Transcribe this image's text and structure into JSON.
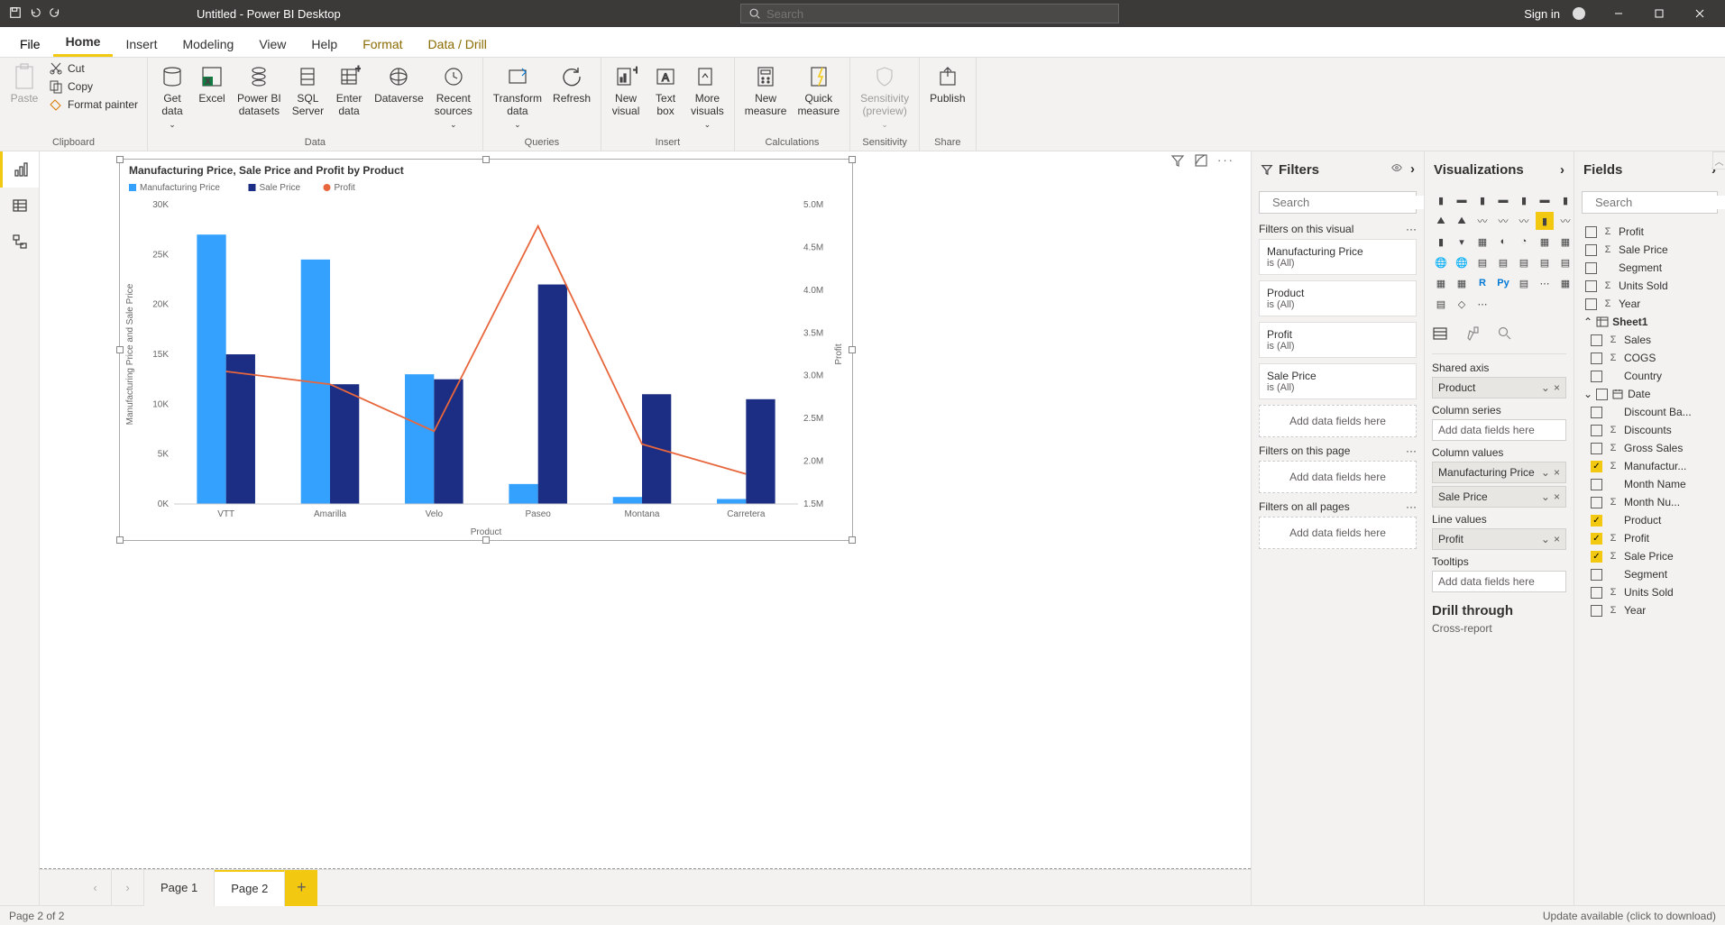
{
  "titlebar": {
    "title": "Untitled - Power BI Desktop",
    "search_placeholder": "Search",
    "signin": "Sign in"
  },
  "tabs": {
    "file": "File",
    "home": "Home",
    "insert": "Insert",
    "modeling": "Modeling",
    "view": "View",
    "help": "Help",
    "format": "Format",
    "datadrill": "Data / Drill"
  },
  "ribbon": {
    "paste": "Paste",
    "cut": "Cut",
    "copy": "Copy",
    "fmtpaint": "Format painter",
    "clipboard": "Clipboard",
    "getdata": "Get\ndata",
    "excel": "Excel",
    "pbi": "Power BI\ndatasets",
    "sql": "SQL\nServer",
    "enter": "Enter\ndata",
    "dataverse": "Dataverse",
    "recent": "Recent\nsources",
    "data_g": "Data",
    "transform": "Transform\ndata",
    "refresh": "Refresh",
    "queries": "Queries",
    "newvis": "New\nvisual",
    "textbox": "Text\nbox",
    "morevis": "More\nvisuals",
    "insert_g": "Insert",
    "newmeas": "New\nmeasure",
    "quickmeas": "Quick\nmeasure",
    "calc_g": "Calculations",
    "sens": "Sensitivity\n(preview)",
    "sens_g": "Sensitivity",
    "publish": "Publish",
    "share_g": "Share"
  },
  "pages": {
    "p1": "Page 1",
    "p2": "Page 2"
  },
  "status": {
    "left": "Page 2 of 2",
    "right": "Update available (click to download)"
  },
  "filters": {
    "title": "Filters",
    "search": "Search",
    "onvisual": "Filters on this visual",
    "cards": [
      {
        "t": "Manufacturing Price",
        "s": "is (All)"
      },
      {
        "t": "Product",
        "s": "is (All)"
      },
      {
        "t": "Profit",
        "s": "is (All)"
      },
      {
        "t": "Sale Price",
        "s": "is (All)"
      }
    ],
    "addhere": "Add data fields here",
    "onpage": "Filters on this page",
    "onall": "Filters on all pages"
  },
  "viz": {
    "title": "Visualizations",
    "shared_axis": "Shared axis",
    "product": "Product",
    "col_series": "Column series",
    "add": "Add data fields here",
    "col_values": "Column values",
    "mfg": "Manufacturing Price",
    "sale": "Sale Price",
    "line_values": "Line values",
    "profit": "Profit",
    "tooltips": "Tooltips",
    "drill": "Drill through",
    "cross": "Cross-report"
  },
  "fields": {
    "title": "Fields",
    "search": "Search",
    "top": [
      {
        "n": "Profit",
        "sig": "Σ",
        "ck": false
      },
      {
        "n": "Sale Price",
        "sig": "Σ",
        "ck": false
      },
      {
        "n": "Segment",
        "sig": "",
        "ck": false
      },
      {
        "n": "Units Sold",
        "sig": "Σ",
        "ck": false
      },
      {
        "n": "Year",
        "sig": "Σ",
        "ck": false
      }
    ],
    "sheet": "Sheet1",
    "sheet_fields": [
      {
        "n": "Sales",
        "sig": "Σ",
        "ck": false
      },
      {
        "n": "COGS",
        "sig": "Σ",
        "ck": false
      },
      {
        "n": "Country",
        "sig": "",
        "ck": false
      }
    ],
    "date": "Date",
    "date_fields": [
      {
        "n": "Discount Ba...",
        "sig": "",
        "ck": false
      },
      {
        "n": "Discounts",
        "sig": "Σ",
        "ck": false
      },
      {
        "n": "Gross Sales",
        "sig": "Σ",
        "ck": false
      },
      {
        "n": "Manufactur...",
        "sig": "Σ",
        "ck": true
      },
      {
        "n": "Month Name",
        "sig": "",
        "ck": false
      },
      {
        "n": "Month Nu...",
        "sig": "Σ",
        "ck": false
      },
      {
        "n": "Product",
        "sig": "",
        "ck": true
      },
      {
        "n": "Profit",
        "sig": "Σ",
        "ck": true
      },
      {
        "n": "Sale Price",
        "sig": "Σ",
        "ck": true
      },
      {
        "n": "Segment",
        "sig": "",
        "ck": false
      },
      {
        "n": "Units Sold",
        "sig": "Σ",
        "ck": false
      },
      {
        "n": "Year",
        "sig": "Σ",
        "ck": false
      }
    ]
  },
  "chart_data": {
    "type": "bar",
    "title": "Manufacturing Price, Sale Price and Profit by Product",
    "xlabel": "Product",
    "ylabel": "Manufacturing Price and Sale Price",
    "y2label": "Profit",
    "ylim": [
      0,
      30000
    ],
    "y2lim": [
      1500000,
      5000000
    ],
    "yticks": [
      "0K",
      "5K",
      "10K",
      "15K",
      "20K",
      "25K",
      "30K"
    ],
    "y2ticks": [
      "1.5M",
      "2.0M",
      "2.5M",
      "3.0M",
      "3.5M",
      "4.0M",
      "4.5M",
      "5.0M"
    ],
    "categories": [
      "VTT",
      "Amarilla",
      "Velo",
      "Paseo",
      "Montana",
      "Carretera"
    ],
    "series": [
      {
        "name": "Manufacturing Price",
        "color": "#33a1fd",
        "values": [
          27000,
          24500,
          13000,
          2000,
          700,
          500
        ]
      },
      {
        "name": "Sale Price",
        "color": "#1c2e83",
        "values": [
          15000,
          12000,
          12500,
          22000,
          11000,
          10500
        ]
      },
      {
        "name": "Profit",
        "color": "#e8663c",
        "type": "line",
        "axis": "y2",
        "values": [
          3050000,
          2900000,
          2350000,
          4750000,
          2200000,
          1850000
        ]
      }
    ],
    "legend": [
      "Manufacturing Price",
      "Sale Price",
      "Profit"
    ]
  }
}
